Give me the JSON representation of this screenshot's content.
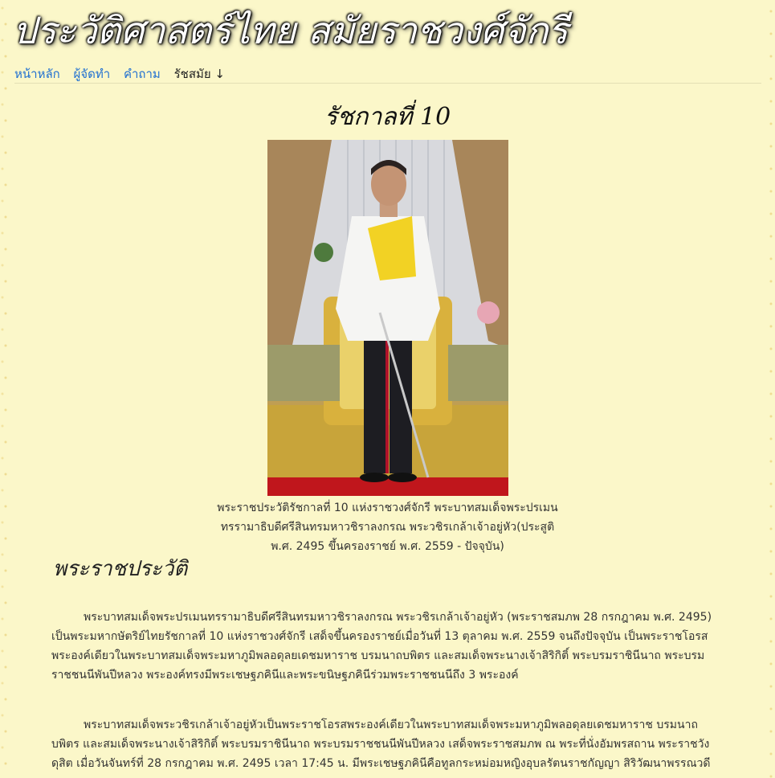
{
  "site": {
    "title": "ประวัติศาสตร์ไทย สมัยราชวงศ์จักรี"
  },
  "nav": {
    "items": [
      {
        "label": "หน้าหลัก",
        "type": "link"
      },
      {
        "label": "ผู้จัดทำ",
        "type": "link"
      },
      {
        "label": "คำถาม",
        "type": "link"
      },
      {
        "label": "รัชสมัย ↓",
        "type": "dropdown"
      }
    ]
  },
  "colors": {
    "background": "#fbf7c9",
    "link": "#1f6fd1"
  },
  "main": {
    "heading": "รัชกาลที่ 10",
    "image": {
      "icon": "portrait-photo"
    },
    "caption": "พระราชประวัติรัชกาลที่ 10 แห่งราชวงศ์จักรี พระบาทสมเด็จพระปรเมนทรรามาธิบดีศรีสินทรมหาวชิราลงกรณ พระวชิรเกล้าเจ้าอยู่หัว(ประสูติ พ.ศ. 2495 ขึ้นครองราชย์ พ.ศ. 2559 - ปัจจุบัน)",
    "section_title": "พระราชประวัติ",
    "paragraphs": [
      "พระบาทสมเด็จพระปรเมนทรรามาธิบดีศรีสินทรมหาวชิราลงกรณ พระวชิรเกล้าเจ้าอยู่หัว (พระราชสมภพ 28 กรกฎาคม พ.ศ. 2495) เป็นพระมหากษัตริย์ไทยรัชกาลที่ 10 แห่งราชวงศ์จักรี เสด็จขึ้นครองราชย์เมื่อวันที่ 13 ตุลาคม พ.ศ. 2559 จนถึงปัจจุบัน เป็นพระราชโอรสพระองค์เดียวในพระบาทสมเด็จพระมหาภูมิพลอดุลยเดชมหาราช บรมนาถบพิตร และสมเด็จพระนางเจ้าสิริกิติ์ พระบรมราชินีนาถ พระบรมราชชนนีพันปีหลวง พระองค์ทรงมีพระเชษฐภคินีและพระขนิษฐภคินีร่วมพระราชชนนีถึง 3 พระองค์",
      "พระบาทสมเด็จพระวชิรเกล้าเจ้าอยู่หัวเป็นพระราชโอรสพระองค์เดียวในพระบาทสมเด็จพระมหาภูมิพลอดุลยเดชมหาราช บรมนาถบพิตร และสมเด็จพระนางเจ้าสิริกิติ์ พระบรมราชินีนาถ พระบรมราชชนนีพันปีหลวง เสด็จพระราชสมภพ ณ พระที่นั่งอัมพรสถาน พระราชวังดุสิต เมื่อวันจันทร์ที่ 28 กรกฎาคม พ.ศ. 2495 เวลา 17:45 น. มีพระเชษฐภคินีคือทูลกระหม่อมหญิงอุบลรัตนราชกัญญา สิริวัฒนาพรรณวดี"
    ]
  }
}
